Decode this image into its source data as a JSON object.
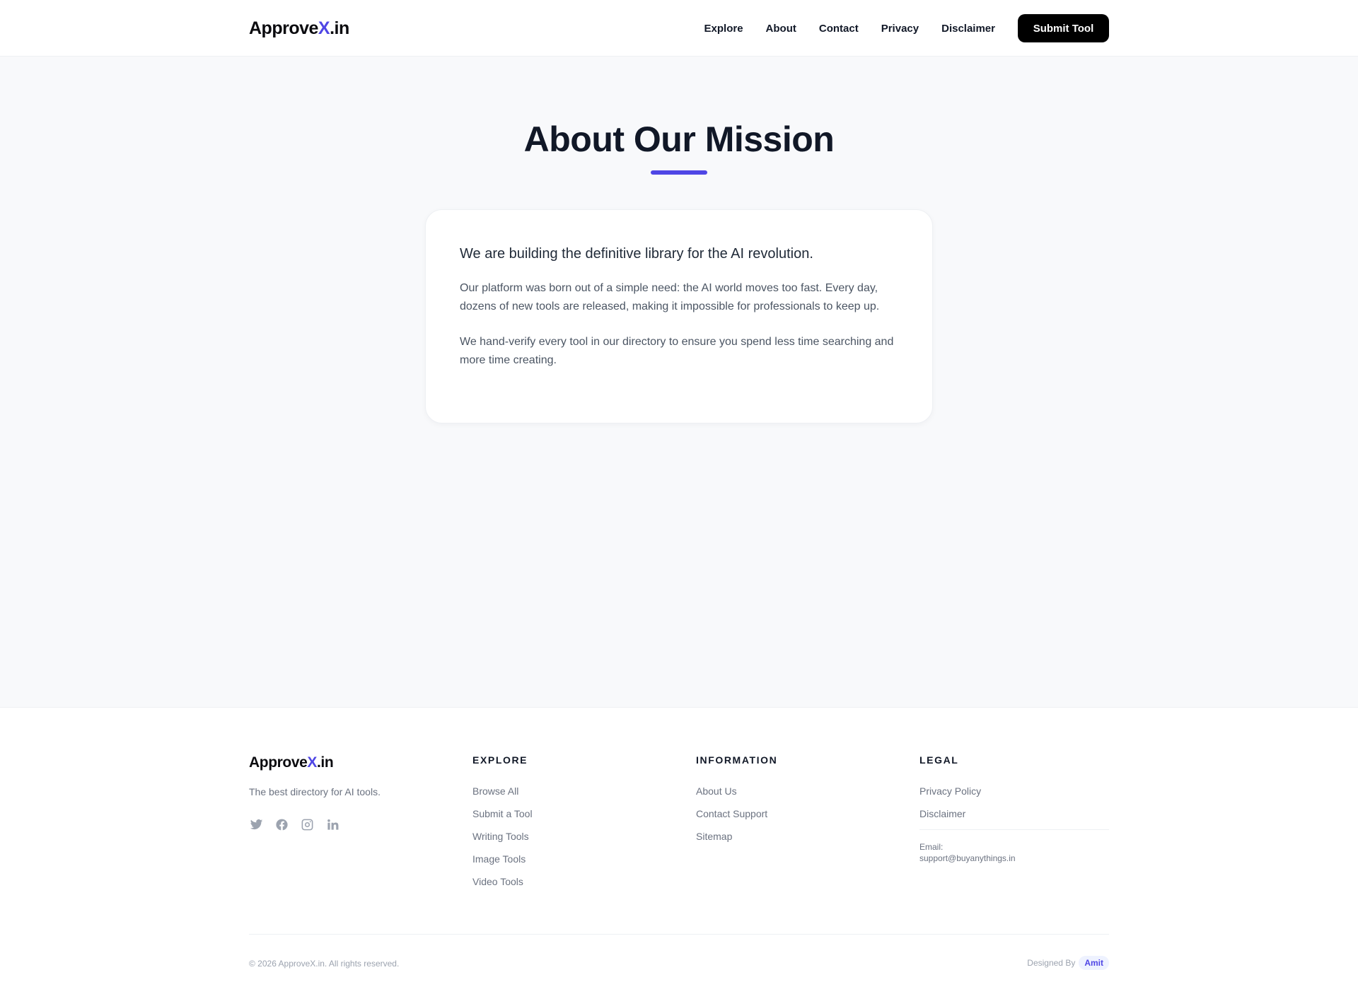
{
  "header": {
    "logo": {
      "prefix": "Approve",
      "accent": "X",
      "suffix": ".in"
    },
    "nav": [
      {
        "label": "Explore"
      },
      {
        "label": "About"
      },
      {
        "label": "Contact"
      },
      {
        "label": "Privacy"
      },
      {
        "label": "Disclaimer"
      }
    ],
    "submit_label": "Submit Tool"
  },
  "main": {
    "title": "About Our Mission",
    "lead": "We are building the definitive library for the AI revolution.",
    "paragraph_1": "Our platform was born out of a simple need: the AI world moves too fast. Every day, dozens of new tools are released, making it impossible for professionals to keep up.",
    "paragraph_2": "We hand-verify every tool in our directory to ensure you spend less time searching and more time creating."
  },
  "footer": {
    "logo": {
      "prefix": "Approve",
      "accent": "X",
      "suffix": ".in"
    },
    "tagline": "The best directory for AI tools.",
    "socials": [
      "twitter-icon",
      "facebook-icon",
      "instagram-icon",
      "linkedin-icon"
    ],
    "explore": {
      "heading": "EXPLORE",
      "links": [
        "Browse All",
        "Submit a Tool",
        "Writing Tools",
        "Image Tools",
        "Video Tools"
      ]
    },
    "information": {
      "heading": "INFORMATION",
      "links": [
        "About Us",
        "Contact Support",
        "Sitemap"
      ]
    },
    "legal": {
      "heading": "LEGAL",
      "links": [
        "Privacy Policy",
        "Disclaimer"
      ],
      "email_label": "Email:",
      "email": "support@buyanythings.in"
    },
    "copyright": "© 2026 ApproveX.in. All rights reserved.",
    "designed_by_label": "Designed By",
    "designer": "Amit"
  },
  "colors": {
    "accent": "#4f46e5",
    "background": "#f8f9fb",
    "button": "#000000"
  }
}
